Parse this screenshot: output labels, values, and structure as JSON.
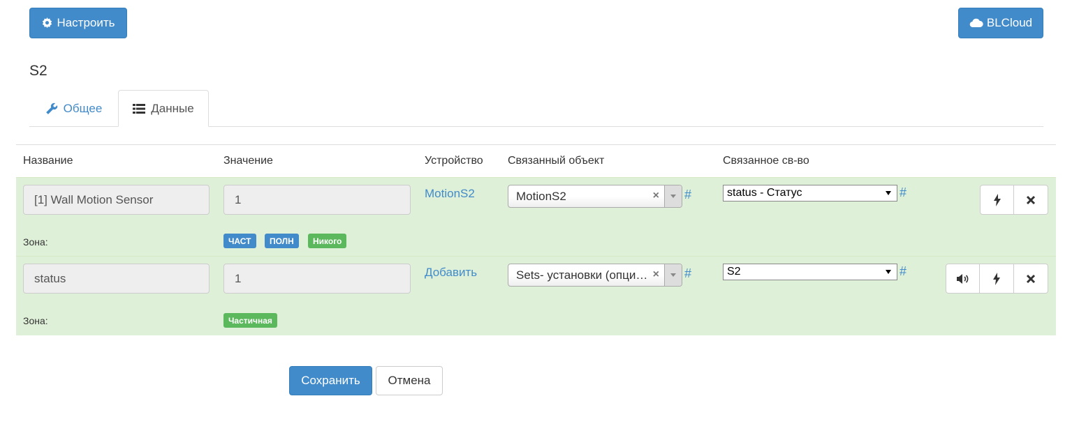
{
  "header": {
    "configure_label": "Настроить",
    "cloud_label": "BLCloud",
    "page_title": "S2"
  },
  "tabs": [
    {
      "label": "Общее",
      "icon": "wrench-icon",
      "active": false
    },
    {
      "label": "Данные",
      "icon": "list-icon",
      "active": true
    }
  ],
  "table": {
    "columns": [
      "Название",
      "Значение",
      "Устройство",
      "Связанный объект",
      "Связанное св-во"
    ],
    "rows": [
      {
        "name": "[1] Wall Motion Sensor",
        "value": "1",
        "device_link": "MotionS2",
        "linked_object": "MotionS2",
        "linked_property": "status - Статус",
        "hash": "#",
        "zone_label": "Зона:",
        "zones": [
          {
            "text": "ЧАСТ",
            "color": "#428bca"
          },
          {
            "text": "ПОЛН",
            "color": "#428bca"
          },
          {
            "text": "Никого",
            "color": "#5cb85c"
          }
        ]
      },
      {
        "name": "status",
        "value": "1",
        "device_link": "Добавить",
        "linked_object": "Sets- установки (опциональные)",
        "linked_property": "S2",
        "hash": "#",
        "zone_label": "Зона:",
        "zones": [
          {
            "text": "Частичная",
            "color": "#5cb85c"
          }
        ]
      }
    ]
  },
  "footer": {
    "save_label": "Сохранить",
    "cancel_label": "Отмена"
  },
  "colors": {
    "primary": "#428bca",
    "success": "#5cb85c",
    "row_bg": "#dff0d8"
  }
}
